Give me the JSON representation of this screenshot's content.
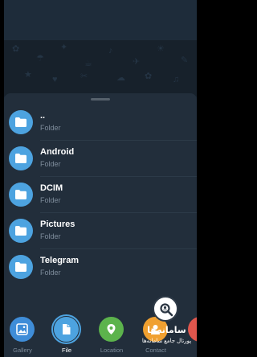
{
  "folders": [
    {
      "name": "..",
      "type": "Folder"
    },
    {
      "name": "Android",
      "type": "Folder"
    },
    {
      "name": "DCIM",
      "type": "Folder"
    },
    {
      "name": "Pictures",
      "type": "Folder"
    },
    {
      "name": "Telegram",
      "type": "Folder"
    }
  ],
  "tabs": [
    {
      "label": "Gallery",
      "color": "#3f8dd8",
      "icon": "image-icon"
    },
    {
      "label": "File",
      "color": "#4da3e0",
      "icon": "file-icon",
      "active": true
    },
    {
      "label": "Location",
      "color": "#5cb34c",
      "icon": "location-pin-icon"
    },
    {
      "label": "Contact",
      "color": "#f0a030",
      "icon": "contact-icon"
    }
  ],
  "watermark": {
    "title": "سامانه‌ها",
    "subtitle": "پورتال جامع سامانه‌ها"
  },
  "colors": {
    "accent": "#4da3e0",
    "sheet": "#222e3b",
    "text_secondary": "#7e8c9b"
  }
}
